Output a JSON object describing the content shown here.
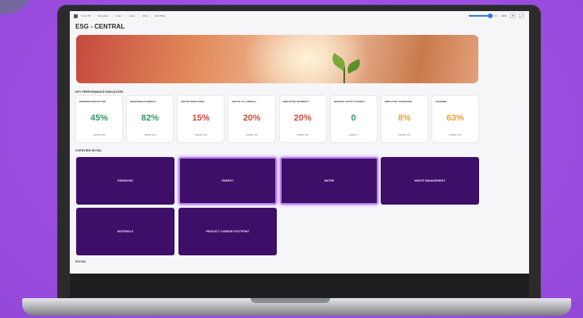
{
  "window": {
    "breadcrumbs": [
      "Power BI",
      "Navigation",
      "Index",
      "Home",
      "ESG",
      "CENTRAL"
    ],
    "zoom_label": "100%",
    "title": "ESG - CENTRAL"
  },
  "sections": {
    "kpi_heading": "KEY PERFORMANCE INDICATORS",
    "overview_heading": "OVERVIEW DETAIL",
    "social_heading": "SOCIAL"
  },
  "kpis": [
    {
      "title": "EMISSION REDUCTION",
      "value": "45%",
      "target": "TARGET 50%",
      "color": "#2e9a61"
    },
    {
      "title": "RENEWABLE ENERGY",
      "value": "82%",
      "target": "TARGET 80%",
      "color": "#2e9a61"
    },
    {
      "title": "WATER REDUCTION",
      "value": "15%",
      "target": "TARGET 30%",
      "color": "#d6483f"
    },
    {
      "title": "WASTE TO LANDFILL",
      "value": "20%",
      "target": "TARGET 10%",
      "color": "#d6483f"
    },
    {
      "title": "EMPLOYEE DIVERSITY",
      "value": "20%",
      "target": "TARGET 40%",
      "color": "#d6483f"
    },
    {
      "title": "SERIOUS SAFETY EVENTS",
      "value": "0",
      "target": "TARGET 0",
      "color": "#2e9a61"
    },
    {
      "title": "EMPLOYEE TURNOVER",
      "value": "8%",
      "target": "TARGET 10%",
      "color": "#e8a23a"
    },
    {
      "title": "TRAINING",
      "value": "63%",
      "target": "TARGET 70%",
      "color": "#e8a23a"
    }
  ],
  "tiles": [
    {
      "label": "EMISSIONS"
    },
    {
      "label": "ENERGY"
    },
    {
      "label": "WATER"
    },
    {
      "label": "WASTE MANAGEMENT"
    },
    {
      "label": "MATERIALS"
    },
    {
      "label": "PRODUCT CARBON FOOTPRINT"
    }
  ],
  "toolbar": {
    "btn1_icon": "pin-icon",
    "btn2_icon": "expand-icon",
    "btn1_glyph": "⊕",
    "btn2_glyph": "⤢"
  }
}
